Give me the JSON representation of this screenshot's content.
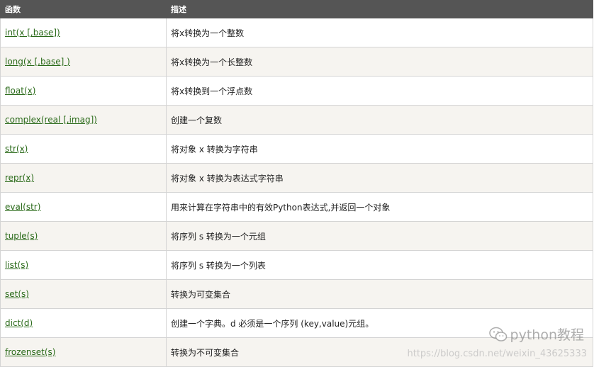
{
  "table": {
    "headers": [
      "函数",
      "描述"
    ],
    "rows": [
      {
        "func": "int(x [,base])",
        "desc": "将x转换为一个整数"
      },
      {
        "func": "long(x [,base] )",
        "desc": "将x转换为一个长整数"
      },
      {
        "func": "float(x)",
        "desc": "将x转换到一个浮点数"
      },
      {
        "func": "complex(real [,imag])",
        "desc": "创建一个复数"
      },
      {
        "func": "str(x)",
        "desc": "将对象 x 转换为字符串"
      },
      {
        "func": "repr(x)",
        "desc": "将对象 x 转换为表达式字符串"
      },
      {
        "func": "eval(str)",
        "desc": "用来计算在字符串中的有效Python表达式,并返回一个对象"
      },
      {
        "func": "tuple(s)",
        "desc": "将序列 s 转换为一个元组"
      },
      {
        "func": "list(s)",
        "desc": "将序列 s 转换为一个列表"
      },
      {
        "func": "set(s)",
        "desc": "转换为可变集合"
      },
      {
        "func": "dict(d)",
        "desc": "创建一个字典。d 必须是一个序列 (key,value)元组。"
      },
      {
        "func": "frozenset(s)",
        "desc": "转换为不可变集合"
      }
    ]
  },
  "watermark": {
    "brand": "python教程",
    "url": "https://blog.csdn.net/weixin_43625333",
    "icon": "wechat-icon"
  },
  "colors": {
    "header_bg": "#555555",
    "link": "#2a6a19",
    "stripe": "#f6f4f0"
  }
}
